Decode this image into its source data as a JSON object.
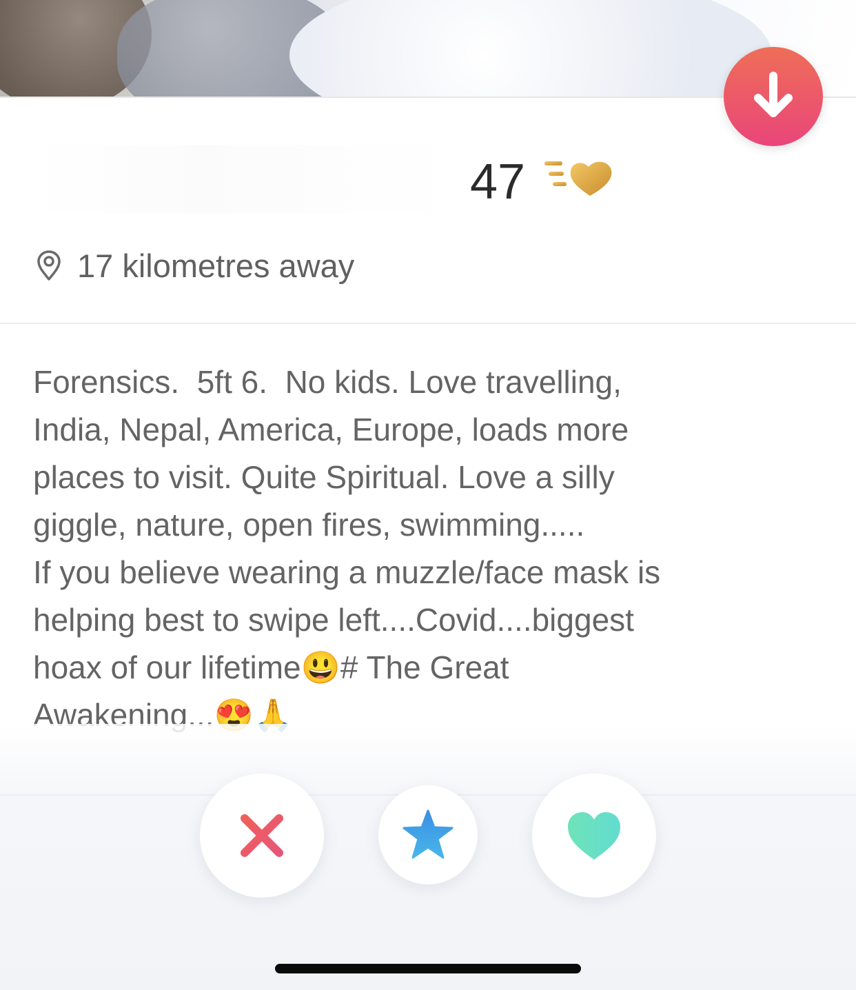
{
  "profile": {
    "age": "47",
    "location": "17 kilometres away",
    "bio": "Forensics.  5ft 6.  No kids. Love travelling,\nIndia, Nepal, America, Europe, loads more\nplaces to visit. Quite Spiritual. Love a silly\ngiggle, nature, open fires, swimming.....\nIf you believe wearing a muzzle/face mask is\nhelping best to swipe left....Covid....biggest\nhoax of our lifetime😃# The Great\nAwakening...😍🙏"
  },
  "icons": {
    "collapse": "arrow-down-icon",
    "superlike_badge": "super-like-heart-icon",
    "location": "location-pin-icon",
    "nope": "x-icon",
    "superlike": "star-icon",
    "like": "heart-icon"
  },
  "colors": {
    "brand_gradient_start": "#ef6e58",
    "brand_gradient_end": "#e9457a",
    "gold": "#d4a043",
    "nope": "#ef5b62",
    "superlike": "#3da0e6",
    "like": "#6fe3c4"
  }
}
